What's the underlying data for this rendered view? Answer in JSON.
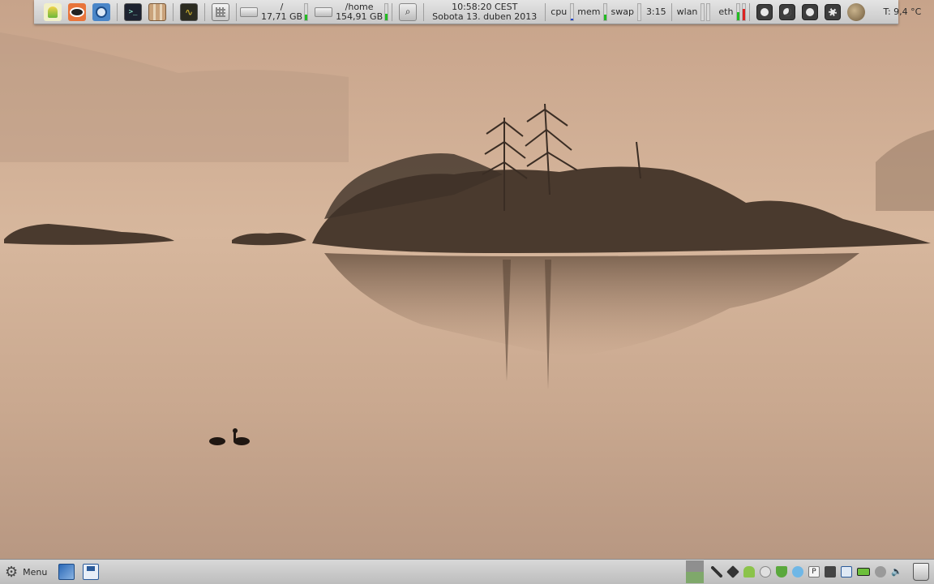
{
  "top_panel": {
    "launchers": [
      "user-icon",
      "eye-viewer-icon",
      "browser-icon",
      "terminal-icon",
      "file-manager-icon",
      "system-monitor-icon",
      "calculator-icon"
    ],
    "disk_root": {
      "mount": "/",
      "size": "17,71 GB",
      "usage": 0.35
    },
    "disk_home": {
      "mount": "/home",
      "size": "154,91 GB",
      "usage": 0.4
    },
    "clock": {
      "time": "10:58:20  CEST",
      "date": "Sobota 13. duben  2013"
    },
    "cpu": {
      "label": "cpu",
      "usage": 0.1
    },
    "mem": {
      "label": "mem",
      "usage": 0.35
    },
    "swap": {
      "label": "swap",
      "usage": 0.0
    },
    "uptime": "3:15",
    "wlan": {
      "label": "wlan"
    },
    "eth": {
      "label": "eth"
    },
    "media_buttons": [
      "power-icon",
      "night-mode-icon",
      "record-icon",
      "settings-icon"
    ],
    "weather": "T: 9,4 °C",
    "colors": {
      "green": "#22bb22",
      "blue": "#2244cc",
      "red": "#dd2222"
    }
  },
  "bottom_panel": {
    "menu_label": "Menu",
    "tasks": [
      "image-editor-task-icon",
      "floppy-save-task-icon"
    ],
    "tray_icons": [
      "pen-icon",
      "dropbox-icon",
      "android-icon",
      "circle-icon",
      "shield-check-icon",
      "bird-icon",
      "p-icon",
      "clipboard-icon",
      "network-icon",
      "battery-icon",
      "keyboard-icon",
      "volume-icon"
    ]
  }
}
